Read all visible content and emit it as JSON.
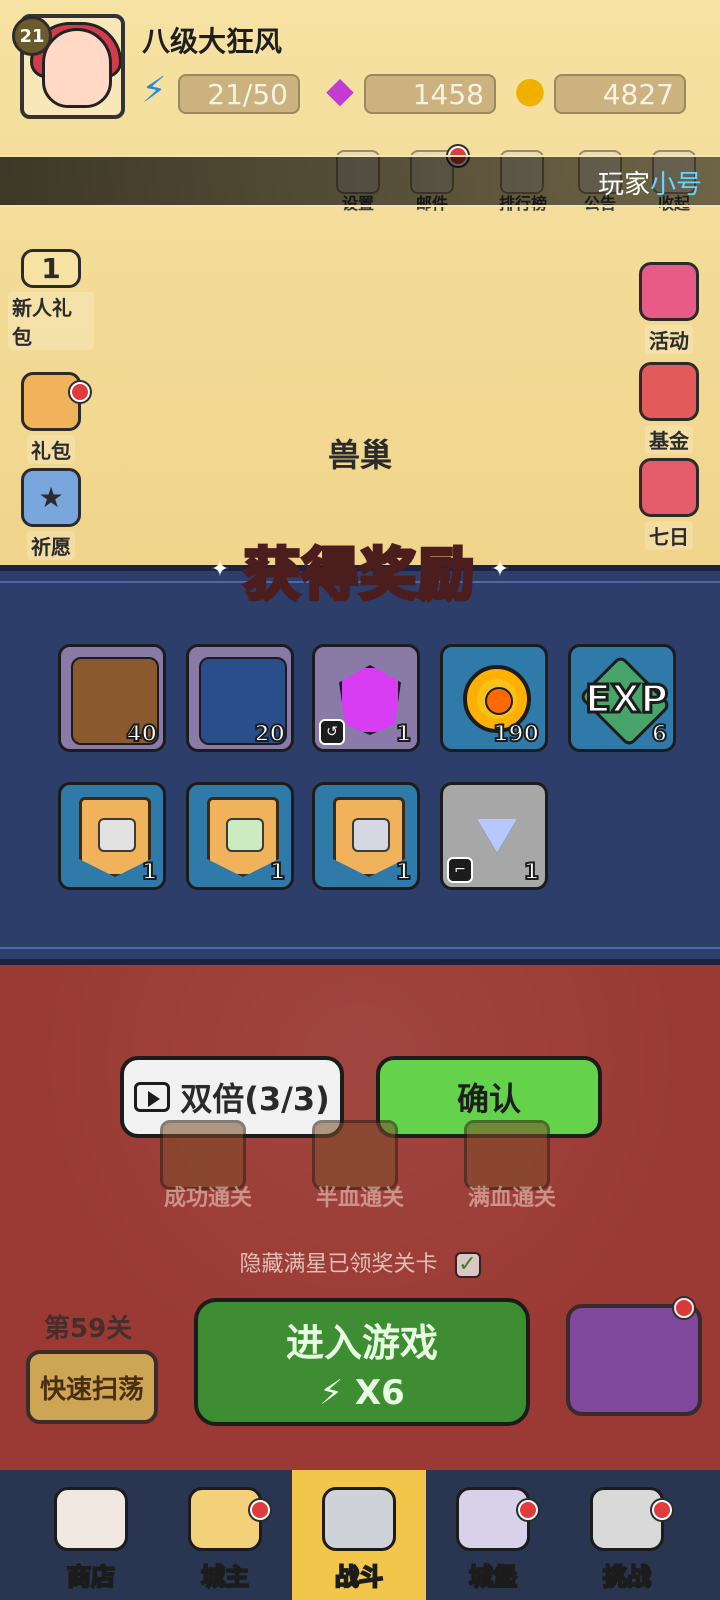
{
  "player": {
    "level": "21",
    "name": "八级大狂风",
    "alt_prefix": "玩家",
    "alt_highlight": "小号"
  },
  "resources": {
    "energy": "21/50",
    "gems": "1458",
    "coins": "4827"
  },
  "top_menu": {
    "settings": "设置",
    "mail": "邮件",
    "ranking": "排行榜",
    "notice": "公告",
    "collapse": "收起"
  },
  "side_left": {
    "newbie_pack_label": "新人礼包",
    "newbie_pack_num": "1",
    "gift_pack": "礼包",
    "wish": "祈愿"
  },
  "side_right": {
    "event": "活动",
    "fund": "基金",
    "seven_days": "七日"
  },
  "area": {
    "name": "兽巢"
  },
  "popup": {
    "title": "获得奖励",
    "items": [
      {
        "icon": "tree-monster-portrait-icon",
        "count": "40",
        "style": "purple"
      },
      {
        "icon": "ice-knight-portrait-icon",
        "count": "20",
        "style": "purple"
      },
      {
        "icon": "purple-gem-icon",
        "count": "1",
        "style": "purple"
      },
      {
        "icon": "gold-coin-icon",
        "count": "190",
        "style": "blue"
      },
      {
        "icon": "exp-icon",
        "label": "EXP",
        "count": "6",
        "style": "blue"
      },
      {
        "icon": "boot-banner-icon",
        "count": "1",
        "style": "blue"
      },
      {
        "icon": "necklace-banner-icon",
        "count": "1",
        "style": "blue"
      },
      {
        "icon": "armor-banner-icon",
        "count": "1",
        "style": "blue"
      },
      {
        "icon": "blue-triangle-gem-icon",
        "count": "1",
        "style": "gray"
      }
    ]
  },
  "buttons": {
    "double": "双倍(3/3)",
    "confirm": "确认"
  },
  "chests": {
    "success": "成功通关",
    "half": "半血通关",
    "full": "满血通关"
  },
  "options": {
    "hide_claimed": "隐藏满星已领奖关卡"
  },
  "stage": {
    "label": "第59关",
    "quick_sweep": "快速扫荡",
    "enter_game": "进入游戏",
    "energy_cost": "X6"
  },
  "nav": {
    "shop": "商店",
    "lord": "城主",
    "battle": "战斗",
    "castle": "城堡",
    "challenge": "挑战"
  }
}
